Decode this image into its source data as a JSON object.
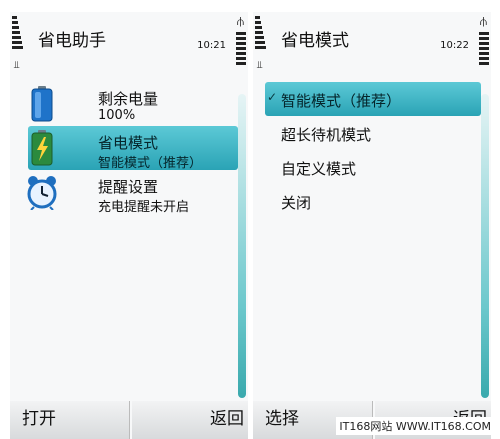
{
  "left": {
    "title": "省电助手",
    "time": "10:21",
    "items": [
      {
        "title": "剩余电量",
        "subtitle": "100%"
      },
      {
        "title": "省电模式",
        "subtitle": "智能模式（推荐）"
      },
      {
        "title": "提醒设置",
        "subtitle": "充电提醒未开启"
      }
    ],
    "lsk": "打开",
    "rsk": "返回"
  },
  "right": {
    "title": "省电模式",
    "time": "10:22",
    "options": [
      "智能模式（推荐）",
      "超长待机模式",
      "自定义模式",
      "关闭"
    ],
    "lsk": "选择",
    "rsk": "返回"
  },
  "watermark": "IT168网站 WWW.IT168.COM",
  "colors": {
    "highlight": "#3fb6c6",
    "scrollbar": "#6cc8cc"
  },
  "icons": [
    "battery-icon",
    "power-saving-icon",
    "alarm-clock-icon",
    "usb-icon",
    "antenna-icon",
    "check-icon"
  ]
}
